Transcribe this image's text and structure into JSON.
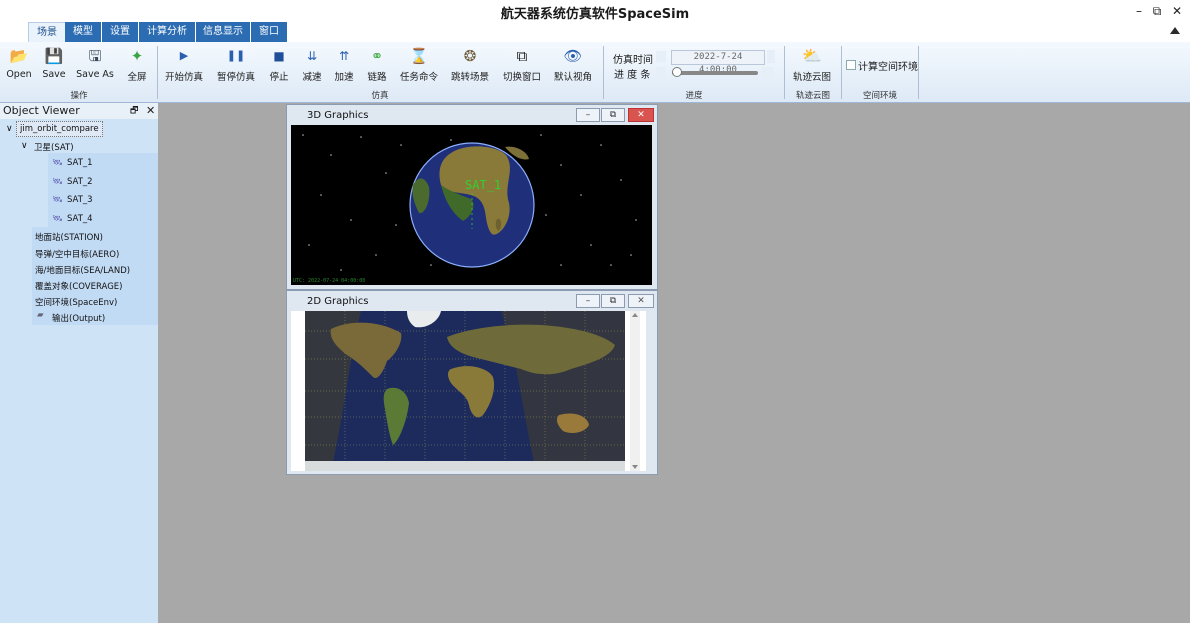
{
  "window": {
    "title": "航天器系统仿真软件SpaceSim",
    "controls": {
      "minimize": "–",
      "restore": "⧉",
      "close": "✕"
    }
  },
  "tabs": [
    {
      "label": "场景",
      "active": true
    },
    {
      "label": "模型"
    },
    {
      "label": "设置"
    },
    {
      "label": "计算分析"
    },
    {
      "label": "信息显示"
    },
    {
      "label": "窗口"
    }
  ],
  "ribbon": {
    "groups": {
      "operation": "操作",
      "simulation": "仿真",
      "progress": "进度",
      "cloud": "轨迹云图",
      "space_env": "空间环境"
    },
    "buttons": {
      "open": "Open",
      "save": "Save",
      "save_as": "Save As",
      "fullscreen": "全屏",
      "start_sim": "开始仿真",
      "pause_sim": "暂停仿真",
      "stop": "停止",
      "slow_down": "减速",
      "speed_up": "加速",
      "link": "链路",
      "task_cmd": "任务命令",
      "jump_scene": "跳转场景",
      "switch_window": "切换窗口",
      "default_view": "默认视角",
      "track_cloud": "轨迹云图"
    },
    "progress": {
      "sim_time_label": "仿真时间",
      "sim_time_value": "2022-7-24 4:00:00",
      "progress_label": "进 度 条",
      "progress_value": 0.0
    },
    "space_env_checkbox": "计算空间环境"
  },
  "object_viewer": {
    "title": "Object Viewer",
    "pin": "🗗",
    "close": "✕",
    "root": "jim_orbit_compare",
    "satellite_group": "卫星(SAT)",
    "satellites": [
      "SAT_1",
      "SAT_2",
      "SAT_3",
      "SAT_4"
    ],
    "categories": [
      "地面站(STATION)",
      "导弹/空中目标(AERO)",
      "海/地面目标(SEA/LAND)",
      "覆盖对象(COVERAGE)",
      "空间环境(SpaceEnv)"
    ],
    "output": "输出(Output)"
  },
  "win3d": {
    "title": "3D Graphics",
    "sat_label": "SAT_1",
    "footer": "UTC: 2022-07-24 04:00:00"
  },
  "win2d": {
    "title": "2D Graphics"
  }
}
